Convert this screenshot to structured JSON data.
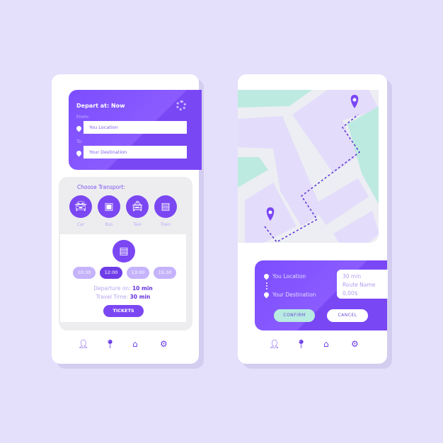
{
  "left_phone": {
    "depart_label": "Depart at:",
    "depart_value": "Now",
    "from_label": "From:",
    "from_value": "You Location",
    "to_label": "To:",
    "to_value": "Your Destination",
    "choose_label": "Choose Transport:",
    "modes": [
      {
        "label": "Car",
        "icon": "car-icon"
      },
      {
        "label": "Bus",
        "icon": "bus-icon"
      },
      {
        "label": "Taxi",
        "icon": "taxi-icon"
      },
      {
        "label": "Train",
        "icon": "train-icon"
      }
    ],
    "selected_mode": "Train",
    "times": [
      "10:30",
      "12:00",
      "13:00",
      "15:30"
    ],
    "selected_time": "12:00",
    "departure_label": "Departure on:",
    "departure_value": "10 min",
    "travel_label": "Travel Time:",
    "travel_value": "30 min",
    "tickets_label": "TICKETS"
  },
  "right_phone": {
    "from": "You Location",
    "to": "Your Destination",
    "duration": "30 min",
    "route_name": "Route Name",
    "price": "0,00$",
    "confirm_label": "CONFIRM",
    "cancel_label": "CANCEL"
  },
  "nav_icons": [
    "user-icon",
    "location-icon",
    "home-icon",
    "settings-icon"
  ],
  "colors": {
    "primary": "#7b47f3",
    "background": "#e4e0fb",
    "map_green": "#bdeae0",
    "map_block": "#e3dcfb",
    "confirm": "#b8ebe1"
  }
}
